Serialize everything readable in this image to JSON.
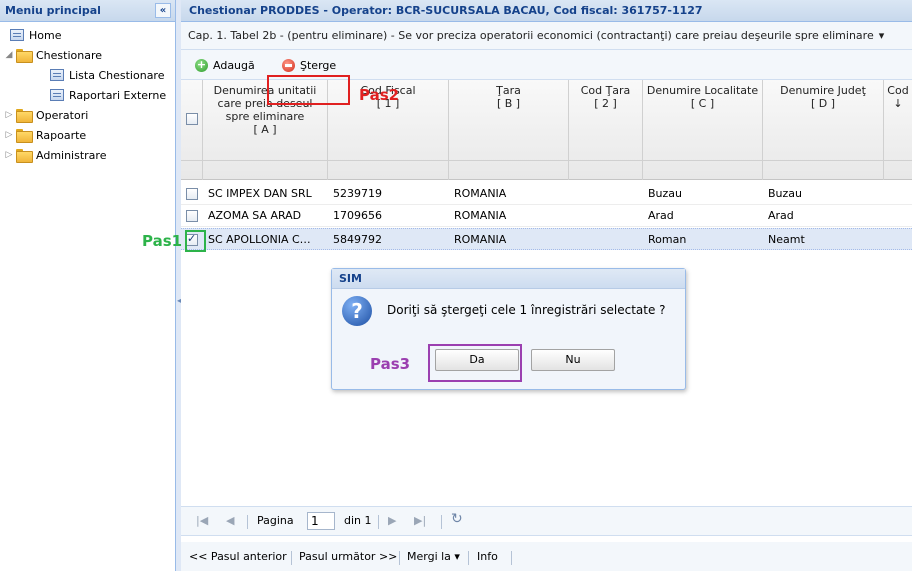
{
  "sidebar": {
    "title": "Meniu principal",
    "collapse_glyph": "«",
    "items": [
      {
        "label": "Home"
      },
      {
        "label": "Chestionare"
      },
      {
        "label": "Lista Chestionare"
      },
      {
        "label": "Raportari Externe"
      },
      {
        "label": "Operatori"
      },
      {
        "label": "Rapoarte"
      },
      {
        "label": "Administrare"
      }
    ]
  },
  "main": {
    "title": "Chestionar PRODDES - Operator: BCR-SUCURSALA BACAU, Cod fiscal: 361757-1127",
    "subtitle": "Cap. 1. Tabel 2b - (pentru eliminare) - Se vor preciza operatorii economici (contractanţi) care preiau deşeurile spre eliminare",
    "subtitle_arrow": "▾"
  },
  "toolbar": {
    "add_label": "Adaugă",
    "delete_label": "Şterge"
  },
  "grid": {
    "columns": [
      {
        "label": "Denumirea unitatii care preia deseul spre eliminare",
        "sub": "[ A ]"
      },
      {
        "label": "Cod Fiscal",
        "sub": "[ 1 ]"
      },
      {
        "label": "Ţara",
        "sub": "[ B ]"
      },
      {
        "label": "Cod Ţara",
        "sub": "[ 2 ]"
      },
      {
        "label": "Denumire Localitate",
        "sub": "[ C ]"
      },
      {
        "label": "Denumire Judeţ",
        "sub": "[ D ]"
      },
      {
        "label": "Cod",
        "sub": "↓"
      }
    ],
    "rows": [
      {
        "name": "SC IMPEX DAN SRL",
        "fiscal": "5239719",
        "country": "ROMANIA",
        "country_code": "",
        "locality": "Buzau",
        "county": "Buzau",
        "checked": false
      },
      {
        "name": "AZOMA SA ARAD",
        "fiscal": "1709656",
        "country": "ROMANIA",
        "country_code": "",
        "locality": "Arad",
        "county": "Arad",
        "checked": false
      },
      {
        "name": "SC APOLLONIA C…",
        "fiscal": "5849792",
        "country": "ROMANIA",
        "country_code": "",
        "locality": "Roman",
        "county": "Neamt",
        "checked": true
      }
    ]
  },
  "dialog": {
    "title": "SIM",
    "icon": "?",
    "message": "Doriţi să ştergeţi cele 1 înregistrări selectate ?",
    "yes_label": "Da",
    "no_label": "Nu"
  },
  "annotations": {
    "step1": "Pas1",
    "step2": "Pas2",
    "step3": "Pas3",
    "colors": {
      "step1": "#2db34a",
      "step2": "#e02020",
      "step3": "#9b3fb0"
    }
  },
  "paging": {
    "first": "|◀",
    "prev": "◀",
    "page_label": "Pagina",
    "page_value": "1",
    "of_label": "din 1",
    "next": "▶",
    "last": "▶|",
    "refresh": "↻"
  },
  "bottom_nav": {
    "prev": "<< Pasul anterior",
    "next": "Pasul următor >>",
    "goto": "Mergi la ▾",
    "info": "Info"
  },
  "colors": {
    "header_text": "#15428b",
    "border": "#99bbe8",
    "selected_row": "#dfe8f6"
  }
}
